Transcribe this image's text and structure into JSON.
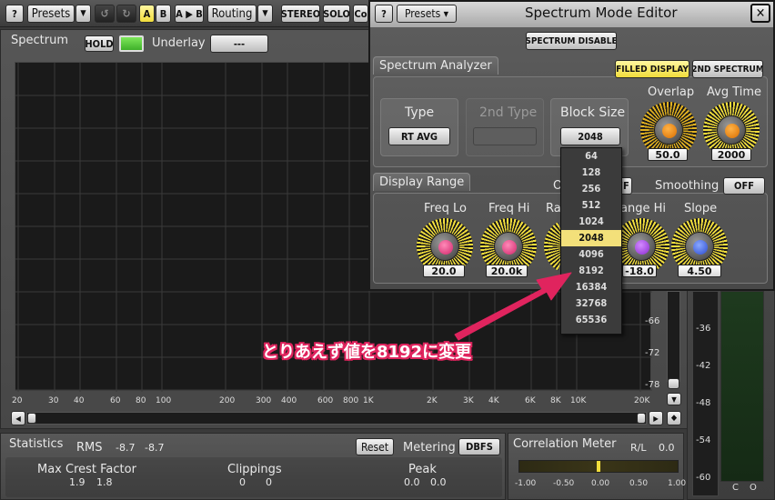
{
  "toolbar": {
    "help": "?",
    "presets": "Presets",
    "a": "A",
    "b": "B",
    "ab": "A ▶ B",
    "routing": "Routing",
    "stereo": "STEREO",
    "solo": "SOLO",
    "co": "Co"
  },
  "spectrum": {
    "title": "Spectrum",
    "hold": "HOLD",
    "underlay_label": "Underlay",
    "underlay_value": "---",
    "freq_ticks": [
      "20",
      "30",
      "40",
      "60",
      "80",
      "100",
      "200",
      "300",
      "400",
      "600",
      "800",
      "1K",
      "2K",
      "3K",
      "4K",
      "6K",
      "8K",
      "10K",
      "20K"
    ],
    "db_ticks": [
      "-66",
      "-72",
      "-78"
    ]
  },
  "statistics": {
    "title": "Statistics",
    "rms_label": "RMS",
    "rms_l": "-8.7",
    "rms_r": "-8.7",
    "reset": "Reset",
    "metering_label": "Metering",
    "metering_value": "DBFS",
    "max_crest_label": "Max Crest Factor",
    "max_crest_l": "1.9",
    "max_crest_r": "1.8",
    "clippings_label": "Clippings",
    "clippings_l": "0",
    "clippings_r": "0",
    "peak_label": "Peak",
    "peak_l": "0.0",
    "peak_r": "0.0"
  },
  "correlation": {
    "title": "Correlation Meter",
    "rl_label": "R/L",
    "rl_value": "0.0",
    "scale": [
      "-1.00",
      "-0.50",
      "0.00",
      "0.50",
      "1.00"
    ]
  },
  "meter": {
    "scale": [
      "-36",
      "-42",
      "-48",
      "-54",
      "-60"
    ],
    "channels": [
      "C",
      "O"
    ]
  },
  "editor": {
    "help": "?",
    "presets": "Presets ▾",
    "title": "Spectrum Mode Editor",
    "close": "✕",
    "spectrum_disable": "SPECTRUM DISABLE",
    "analyzer_tab": "Spectrum Analyzer",
    "filled_display": "FILLED DISPLAY",
    "second_spectrum": "2ND SPECTRUM",
    "type_label": "Type",
    "type_value": "RT AVG",
    "second_type_label": "2nd Type",
    "block_size_label": "Block Size",
    "block_size_value": "2048",
    "overlap_label": "Overlap",
    "overlap_value": "50.0",
    "avg_time_label": "Avg Time",
    "avg_time_value": "2000",
    "display_range_tab": "Display Range",
    "o_label": "O",
    "ff_value": "FF",
    "smoothing_label": "Smoothing",
    "smoothing_value": "OFF",
    "freq_lo_label": "Freq Lo",
    "freq_lo_value": "20.0",
    "freq_hi_label": "Freq Hi",
    "freq_hi_value": "20.0k",
    "ra_label": "Ra",
    "range_hi_label": "ange Hi",
    "range_hi_value": "-18.0",
    "slope_label": "Slope",
    "slope_value": "4.50"
  },
  "block_size_options": [
    "64",
    "128",
    "256",
    "512",
    "1024",
    "2048",
    "4096",
    "8192",
    "16384",
    "32768",
    "65536"
  ],
  "block_size_selected": "2048",
  "annotation": "とりあえず値を8192に変更",
  "colors": {
    "accent_yellow": "#f1dd3c",
    "annotation_pink": "#e0245e",
    "led_green": "#4ccf2f"
  }
}
